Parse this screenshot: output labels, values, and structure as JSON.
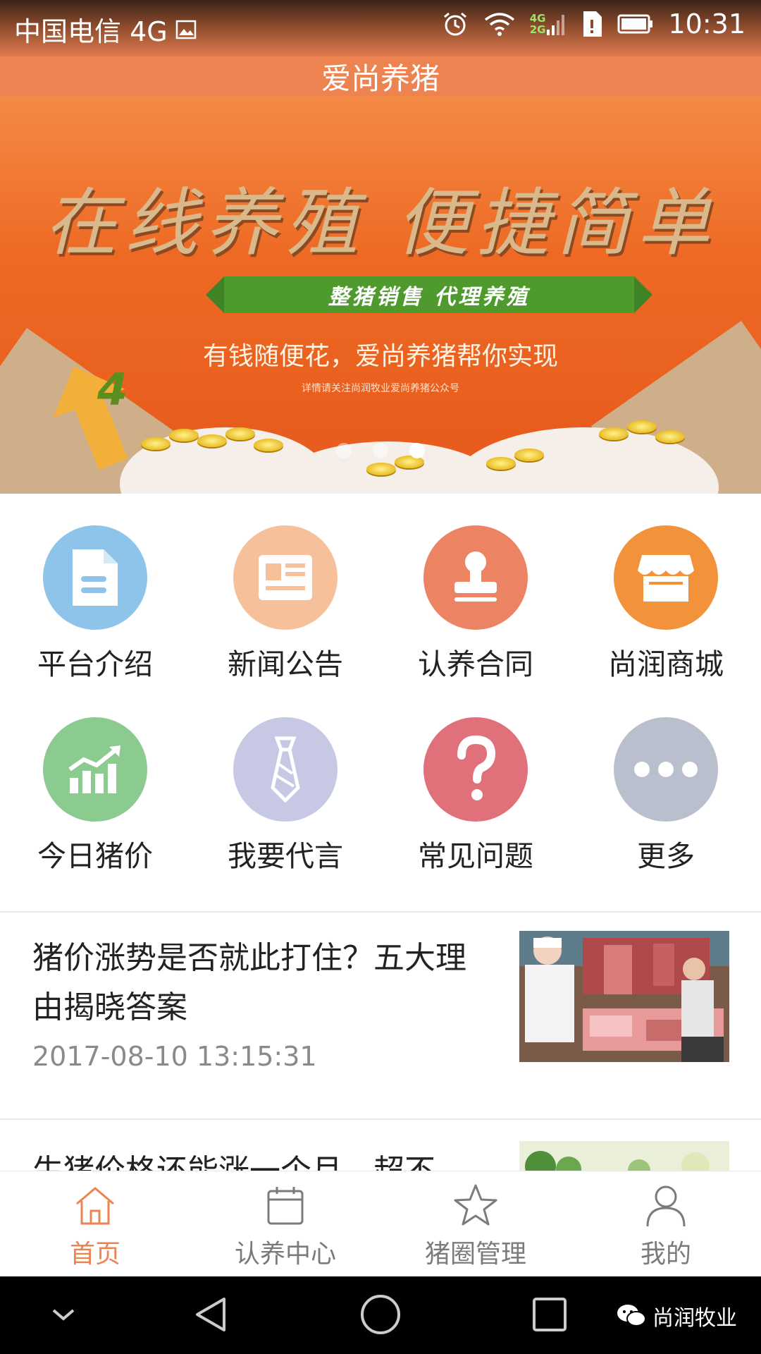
{
  "status_bar": {
    "carrier": "中国电信 4G",
    "network_badge_top": "4G",
    "network_badge_bottom": "2G",
    "time": "10:31"
  },
  "header": {
    "title": "爱尚养猪"
  },
  "banner": {
    "headline": "在线养殖 便捷简单",
    "ribbon": "整猪销售 代理养殖",
    "slogan": "有钱随便花，爱尚养猪帮你实现",
    "note": "详情请关注尚润牧业爱尚养猪公众号",
    "arrow_number": "4",
    "slides": 3,
    "active_slide": 3
  },
  "grid": {
    "items": [
      {
        "label": "平台介绍",
        "icon": "document-icon",
        "color": "#8ec3ea"
      },
      {
        "label": "新闻公告",
        "icon": "newspaper-icon",
        "color": "#f6c19a"
      },
      {
        "label": "认养合同",
        "icon": "stamp-icon",
        "color": "#ec8464"
      },
      {
        "label": "尚润商城",
        "icon": "store-icon",
        "color": "#f2933c"
      },
      {
        "label": "今日猪价",
        "icon": "chart-icon",
        "color": "#8ccb8f"
      },
      {
        "label": "我要代言",
        "icon": "tie-icon",
        "color": "#c6c8e4"
      },
      {
        "label": "常见问题",
        "icon": "question-icon",
        "color": "#e0707a"
      },
      {
        "label": "更多",
        "icon": "more-icon",
        "color": "#b9bfcc"
      }
    ]
  },
  "news": [
    {
      "title": "猪价涨势是否就此打住？五大理由揭晓答案",
      "time": "2017-08-10 13:15:31"
    },
    {
      "title": "生猪价格还能涨一个月，超不",
      "time": ""
    }
  ],
  "tabs": [
    {
      "label": "首页",
      "icon": "home-icon",
      "active": true
    },
    {
      "label": "认养中心",
      "icon": "calendar-icon",
      "active": false
    },
    {
      "label": "猪圈管理",
      "icon": "star-icon",
      "active": false
    },
    {
      "label": "我的",
      "icon": "person-icon",
      "active": false
    }
  ],
  "watermark": "尚润牧业",
  "colors": {
    "accent": "#ee8352",
    "tab_inactive": "#7b7b7b"
  }
}
